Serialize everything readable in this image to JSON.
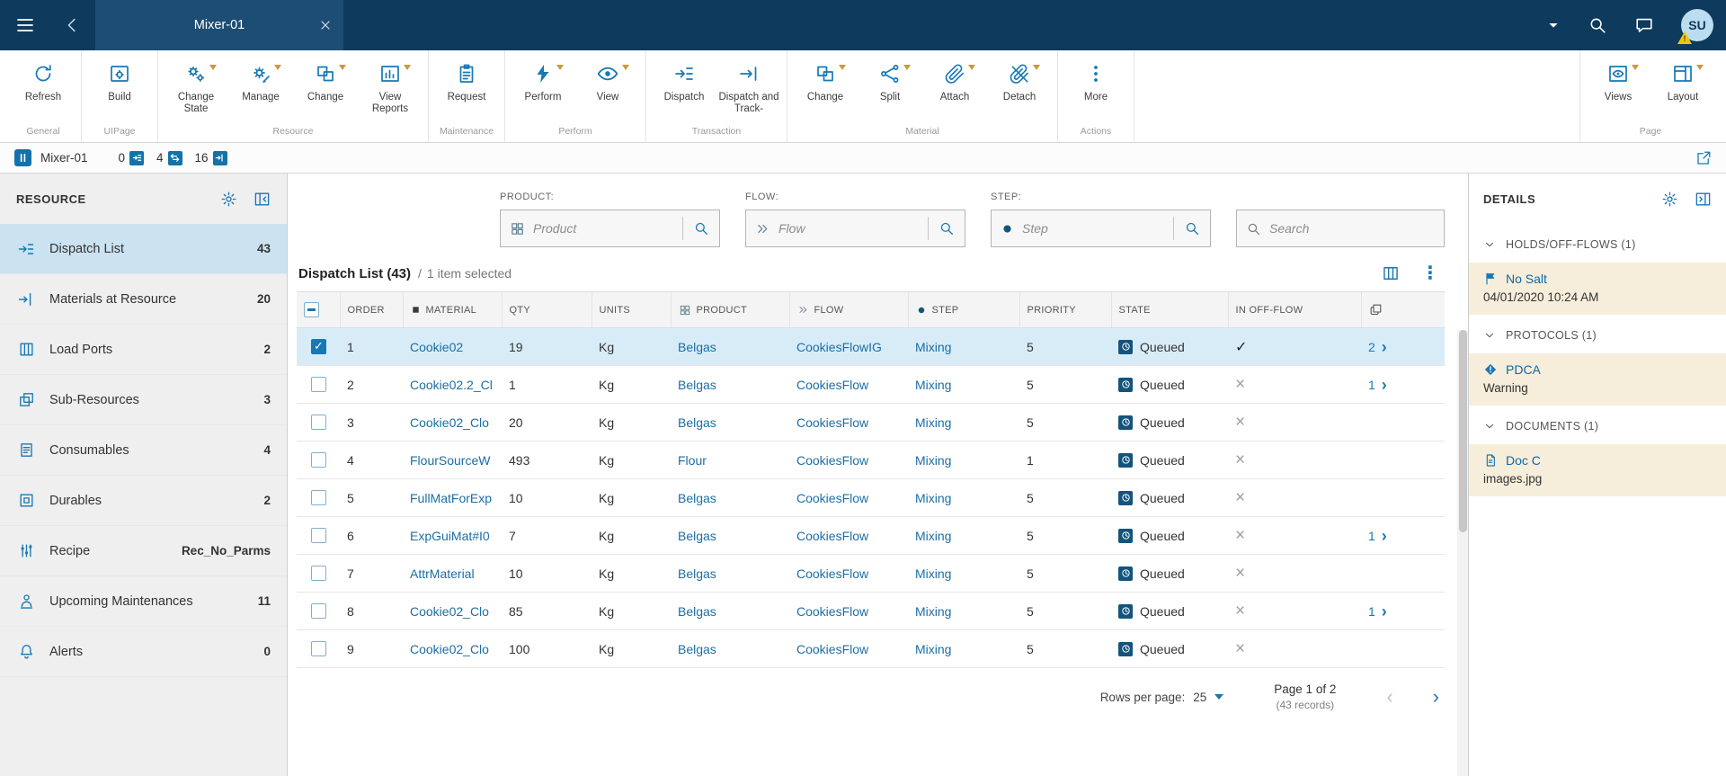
{
  "colors": {
    "topbar_bg": "#0d3a5d",
    "tab_bg": "#1d4d73",
    "accent_blue": "#1878b4",
    "link_blue": "#1c6ea4",
    "selected_row_bg": "#d8ecf8",
    "selected_nav_bg": "#cbe2f1",
    "dropdown_caret_gold": "#c79a3b",
    "details_card_bg": "#f6eedb",
    "state_icon_bg": "#14547c",
    "warning_yellow": "#f2c500"
  },
  "topbar": {
    "tab_title": "Mixer-01",
    "avatar_initials": "SU"
  },
  "ribbon": {
    "groups": [
      {
        "name": "General",
        "buttons": [
          {
            "label": "Refresh",
            "caret": false
          }
        ]
      },
      {
        "name": "UIPage",
        "buttons": [
          {
            "label": "Build",
            "caret": false
          }
        ]
      },
      {
        "name": "Resource",
        "buttons": [
          {
            "label": "Change State",
            "caret": true
          },
          {
            "label": "Manage",
            "caret": true
          },
          {
            "label": "Change",
            "caret": true
          },
          {
            "label": "View Reports",
            "caret": true
          }
        ]
      },
      {
        "name": "Maintenance",
        "buttons": [
          {
            "label": "Request",
            "caret": false
          }
        ]
      },
      {
        "name": "Perform",
        "buttons": [
          {
            "label": "Perform",
            "caret": true
          },
          {
            "label": "View",
            "caret": true
          }
        ]
      },
      {
        "name": "Transaction",
        "buttons": [
          {
            "label": "Dispatch",
            "caret": false
          },
          {
            "label": "Dispatch and Track-",
            "caret": false
          }
        ]
      },
      {
        "name": "Material",
        "buttons": [
          {
            "label": "Change",
            "caret": true
          },
          {
            "label": "Split",
            "caret": true
          },
          {
            "label": "Attach",
            "caret": true
          },
          {
            "label": "Detach",
            "caret": true
          }
        ]
      },
      {
        "name": "Actions",
        "buttons": [
          {
            "label": "More",
            "caret": false
          }
        ]
      },
      {
        "name": "Page",
        "buttons": [
          {
            "label": "Views",
            "caret": true
          },
          {
            "label": "Layout",
            "caret": true
          }
        ]
      }
    ]
  },
  "statusbar": {
    "resource_name": "Mixer-01",
    "counts": [
      {
        "value": "0"
      },
      {
        "value": "4"
      },
      {
        "value": "16"
      }
    ]
  },
  "sidebar": {
    "title": "RESOURCE",
    "items": [
      {
        "label": "Dispatch List",
        "value": "43",
        "selected": true
      },
      {
        "label": "Materials at Resource",
        "value": "20"
      },
      {
        "label": "Load Ports",
        "value": "2"
      },
      {
        "label": "Sub-Resources",
        "value": "3"
      },
      {
        "label": "Consumables",
        "value": "4"
      },
      {
        "label": "Durables",
        "value": "2"
      },
      {
        "label": "Recipe",
        "value": "Rec_No_Parms"
      },
      {
        "label": "Upcoming Maintenances",
        "value": "11"
      },
      {
        "label": "Alerts",
        "value": "0"
      }
    ]
  },
  "filters": {
    "product_label": "PRODUCT:",
    "flow_label": "FLOW:",
    "step_label": "STEP:",
    "product_placeholder": "Product",
    "flow_placeholder": "Flow",
    "step_placeholder": "Step",
    "search_placeholder": "Search"
  },
  "table": {
    "title": "Dispatch List (43)",
    "separator": "/",
    "selection_info": "1 item selected",
    "columns": [
      "ORDER",
      "MATERIAL",
      "QTY",
      "UNITS",
      "PRODUCT",
      "FLOW",
      "STEP",
      "PRIORITY",
      "STATE",
      "IN OFF-FLOW"
    ],
    "rows": [
      {
        "order": "1",
        "material": "Cookie02",
        "qty": "19",
        "units": "Kg",
        "product": "Belgas",
        "flow": "CookiesFlowIG",
        "step": "Mixing",
        "priority": "5",
        "state": "Queued",
        "in_off_flow": true,
        "link_count": "2",
        "selected": true
      },
      {
        "order": "2",
        "material": "Cookie02.2_Cl",
        "qty": "1",
        "units": "Kg",
        "product": "Belgas",
        "flow": "CookiesFlow",
        "step": "Mixing",
        "priority": "5",
        "state": "Queued",
        "in_off_flow": false,
        "link_count": "1"
      },
      {
        "order": "3",
        "material": "Cookie02_Clo",
        "qty": "20",
        "units": "Kg",
        "product": "Belgas",
        "flow": "CookiesFlow",
        "step": "Mixing",
        "priority": "5",
        "state": "Queued",
        "in_off_flow": false,
        "link_count": ""
      },
      {
        "order": "4",
        "material": "FlourSourceW",
        "qty": "493",
        "units": "Kg",
        "product": "Flour",
        "flow": "CookiesFlow",
        "step": "Mixing",
        "priority": "1",
        "state": "Queued",
        "in_off_flow": false,
        "link_count": ""
      },
      {
        "order": "5",
        "material": "FullMatForExp",
        "qty": "10",
        "units": "Kg",
        "product": "Belgas",
        "flow": "CookiesFlow",
        "step": "Mixing",
        "priority": "5",
        "state": "Queued",
        "in_off_flow": false,
        "link_count": ""
      },
      {
        "order": "6",
        "material": "ExpGuiMat#I0",
        "qty": "7",
        "units": "Kg",
        "product": "Belgas",
        "flow": "CookiesFlow",
        "step": "Mixing",
        "priority": "5",
        "state": "Queued",
        "in_off_flow": false,
        "link_count": "1"
      },
      {
        "order": "7",
        "material": "AttrMaterial",
        "qty": "10",
        "units": "Kg",
        "product": "Belgas",
        "flow": "CookiesFlow",
        "step": "Mixing",
        "priority": "5",
        "state": "Queued",
        "in_off_flow": false,
        "link_count": ""
      },
      {
        "order": "8",
        "material": "Cookie02_Clo",
        "qty": "85",
        "units": "Kg",
        "product": "Belgas",
        "flow": "CookiesFlow",
        "step": "Mixing",
        "priority": "5",
        "state": "Queued",
        "in_off_flow": false,
        "link_count": "1"
      },
      {
        "order": "9",
        "material": "Cookie02_Clo",
        "qty": "100",
        "units": "Kg",
        "product": "Belgas",
        "flow": "CookiesFlow",
        "step": "Mixing",
        "priority": "5",
        "state": "Queued",
        "in_off_flow": false,
        "link_count": ""
      }
    ]
  },
  "pagination": {
    "rows_per_page_label": "Rows per page:",
    "rows_per_page_value": "25",
    "page_info": "Page 1 of 2",
    "records_info": "(43 records)"
  },
  "details": {
    "title": "DETAILS",
    "sections": [
      {
        "title": "HOLDS/OFF-FLOWS (1)",
        "item": {
          "name": "No Salt",
          "subtitle": "04/01/2020 10:24 AM"
        }
      },
      {
        "title": "PROTOCOLS (1)",
        "item": {
          "name": "PDCA",
          "subtitle": "Warning"
        }
      },
      {
        "title": "DOCUMENTS (1)",
        "item": {
          "name": "Doc C",
          "subtitle": "images.jpg"
        }
      }
    ]
  }
}
